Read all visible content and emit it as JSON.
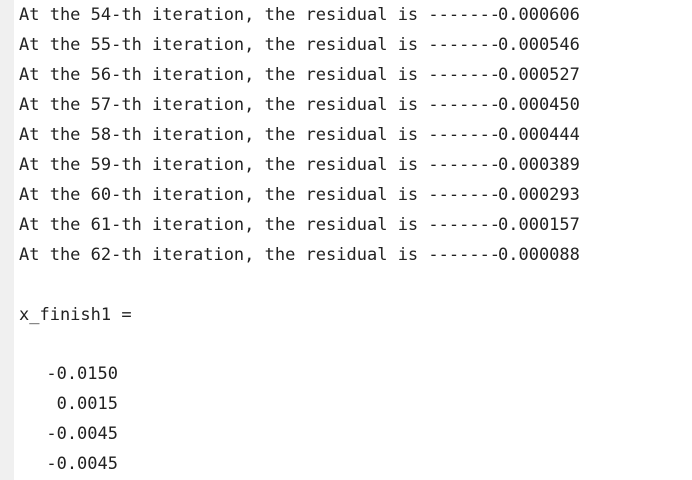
{
  "console": {
    "iterations": [
      {
        "text": "At the 54-th iteration, the residual is -------",
        "value": "0.000606"
      },
      {
        "text": "At the 55-th iteration, the residual is -------",
        "value": "0.000546"
      },
      {
        "text": "At the 56-th iteration, the residual is -------",
        "value": "0.000527"
      },
      {
        "text": "At the 57-th iteration, the residual is -------",
        "value": "0.000450"
      },
      {
        "text": "At the 58-th iteration, the residual is -------",
        "value": "0.000444"
      },
      {
        "text": "At the 59-th iteration, the residual is -------",
        "value": "0.000389"
      },
      {
        "text": "At the 60-th iteration, the residual is -------",
        "value": "0.000293"
      },
      {
        "text": "At the 61-th iteration, the residual is -------",
        "value": "0.000157"
      },
      {
        "text": "At the 62-th iteration, the residual is -------",
        "value": "0.000088"
      }
    ],
    "variable_line": "x_finish1 =",
    "vector": [
      "-0.0150",
      "0.0015",
      "-0.0045",
      "-0.0045"
    ]
  }
}
